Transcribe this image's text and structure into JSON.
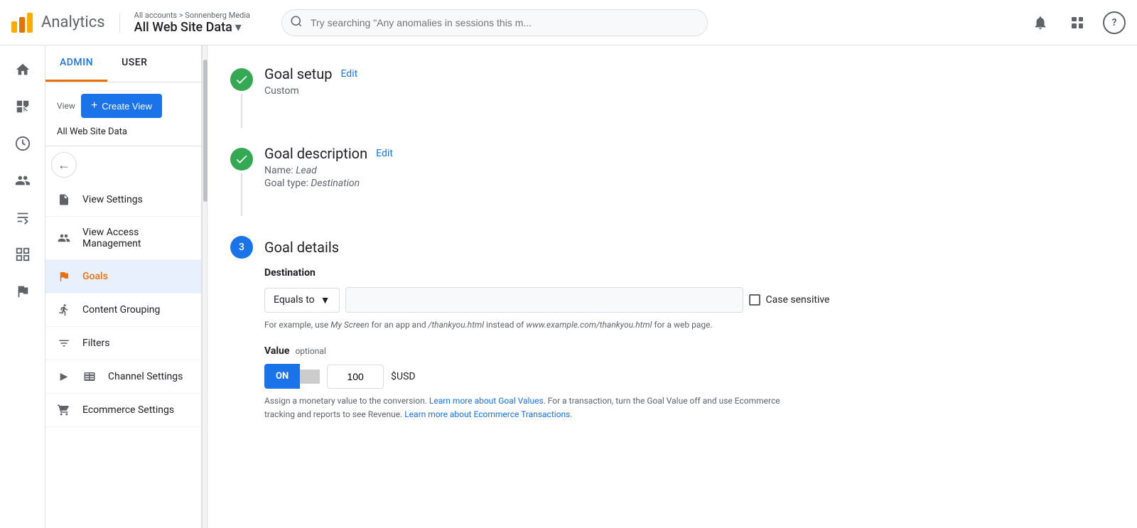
{
  "header": {
    "logo_text": "Analytics",
    "account_path": "All accounts > Sonnenberg Media",
    "account_name": "All Web Site Data",
    "search_placeholder": "Try searching \"Any anomalies in sessions this m...",
    "nav_icons": [
      "bell",
      "grid",
      "help"
    ]
  },
  "admin_tabs": [
    {
      "label": "ADMIN",
      "active": true
    },
    {
      "label": "USER",
      "active": false
    }
  ],
  "view_section": {
    "view_label": "View",
    "create_btn": "Create View",
    "view_name": "All Web Site Data"
  },
  "nav_items": [
    {
      "id": "view-settings",
      "label": "View Settings",
      "icon": "document"
    },
    {
      "id": "view-access",
      "label": "View Access Management",
      "icon": "users"
    },
    {
      "id": "goals",
      "label": "Goals",
      "icon": "flag",
      "active": true
    },
    {
      "id": "content-grouping",
      "label": "Content Grouping",
      "icon": "person"
    },
    {
      "id": "filters",
      "label": "Filters",
      "icon": "filter"
    },
    {
      "id": "channel-settings",
      "label": "Channel Settings",
      "icon": "table",
      "expandable": true
    },
    {
      "id": "ecommerce",
      "label": "Ecommerce Settings",
      "icon": "cart"
    }
  ],
  "goal": {
    "step1": {
      "title": "Goal setup",
      "edit_label": "Edit",
      "subtitle": "Custom",
      "completed": true
    },
    "step2": {
      "title": "Goal description",
      "edit_label": "Edit",
      "name_label": "Name:",
      "name_value": "Lead",
      "type_label": "Goal type:",
      "type_value": "Destination",
      "completed": true
    },
    "step3": {
      "number": "3",
      "title": "Goal details",
      "destination_label": "Destination",
      "equals_to": "Equals to",
      "case_sensitive_label": "Case sensitive",
      "hint_text": "For example, use My Screen for an app and /thankyou.html instead of www.example.com/thankyou.html for a web page.",
      "hint_italic1": "My Screen",
      "hint_italic2": "/thankyou.html",
      "hint_italic3": "www.example.com/thankyou.html",
      "value_label": "Value",
      "optional_label": "optional",
      "toggle_on": "ON",
      "value_amount": "100",
      "currency": "$USD",
      "assign_text_1": "Assign a monetary value to the conversion. ",
      "learn_more_1": "Learn more about Goal Values",
      "assign_text_2": ". For a transaction, turn the Goal Value off and use Ecommerce tracking and reports to see Revenue. ",
      "learn_more_2": "Learn more about Ecommerce Transactions",
      "assign_text_3": "."
    }
  }
}
